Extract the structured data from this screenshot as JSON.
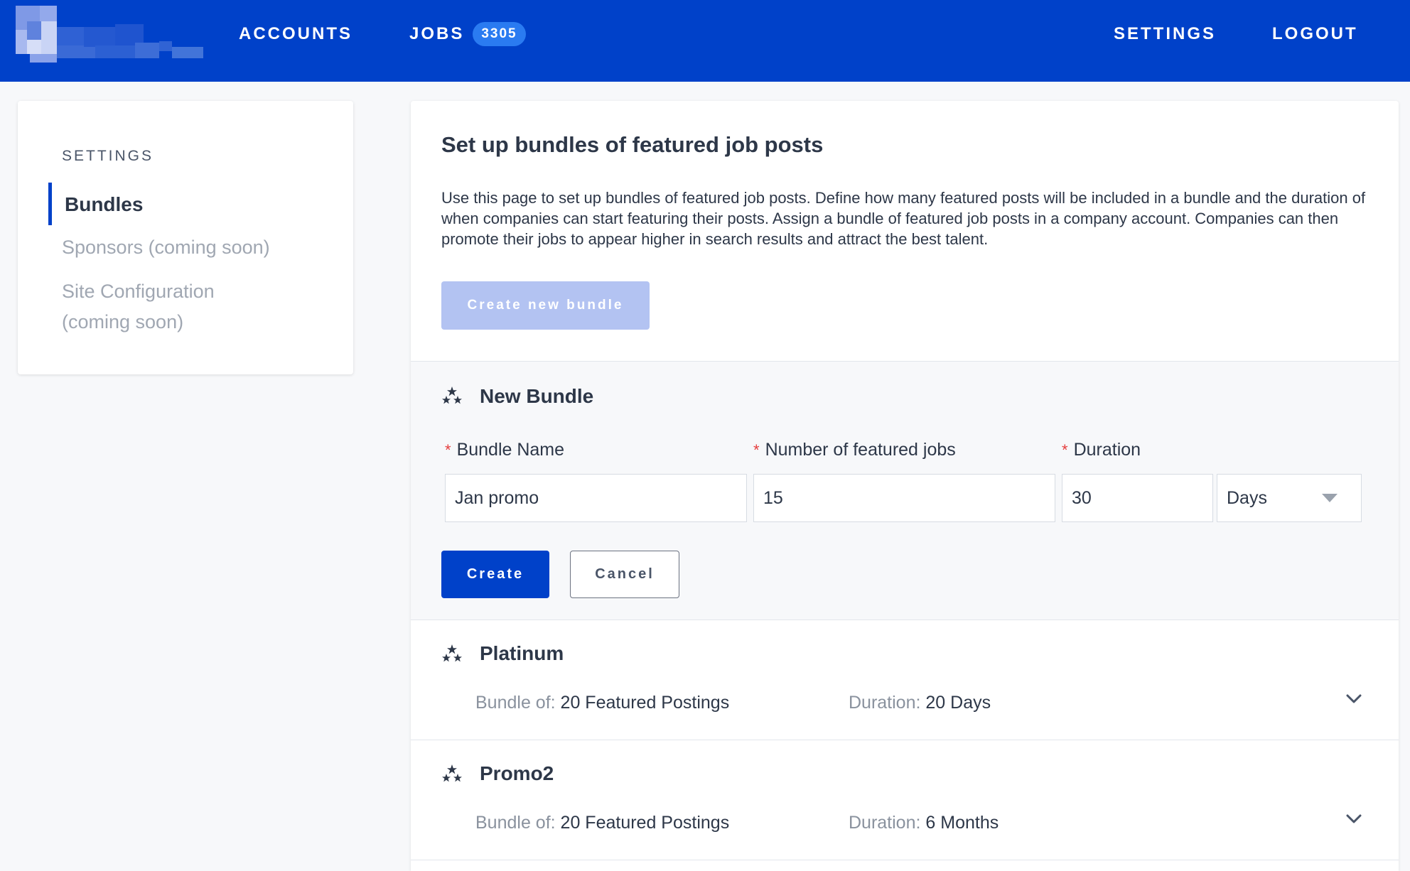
{
  "header": {
    "nav": {
      "accounts": "ACCOUNTS",
      "jobs": "JOBS",
      "jobs_count": "3305",
      "settings": "SETTINGS",
      "logout": "LOGOUT"
    },
    "brand_color": "#0041c9"
  },
  "sidebar": {
    "heading": "SETTINGS",
    "items": [
      {
        "label": "Bundles",
        "active": true
      },
      {
        "label": "Sponsors (coming soon)",
        "active": false
      },
      {
        "label": "Site Configuration",
        "label_line2": "(coming soon)",
        "active": false
      }
    ]
  },
  "main": {
    "title": "Set up bundles of featured job posts",
    "description": "Use this page to set up bundles of featured job posts. Define how many featured posts will be included in a bundle and the duration of when companies can start featuring their posts. Assign a bundle of featured job posts in a company account. Companies can then promote their jobs to appear higher in search results and attract the best talent.",
    "create_new_bundle_label": "Create new bundle",
    "new_bundle_form": {
      "title": "New Bundle",
      "required_mark": "*",
      "bundle_name_label": "Bundle Name",
      "bundle_name_value": "Jan promo",
      "featured_jobs_label": "Number of featured jobs",
      "featured_jobs_value": "15",
      "duration_label": "Duration",
      "duration_value": "30",
      "duration_unit": "Days",
      "create_label": "Create",
      "cancel_label": "Cancel"
    },
    "bundles": [
      {
        "name": "Platinum",
        "bundle_of_key": "Bundle of:",
        "bundle_of_value": "20 Featured Postings",
        "duration_key": "Duration:",
        "duration_value": "20 Days"
      },
      {
        "name": "Promo2",
        "bundle_of_key": "Bundle of:",
        "bundle_of_value": "20 Featured Postings",
        "duration_key": "Duration:",
        "duration_value": "6 Months"
      }
    ]
  },
  "icons": {
    "bundle": "stars-icon",
    "expand": "chevron-down-icon",
    "select": "caret-down-icon"
  }
}
